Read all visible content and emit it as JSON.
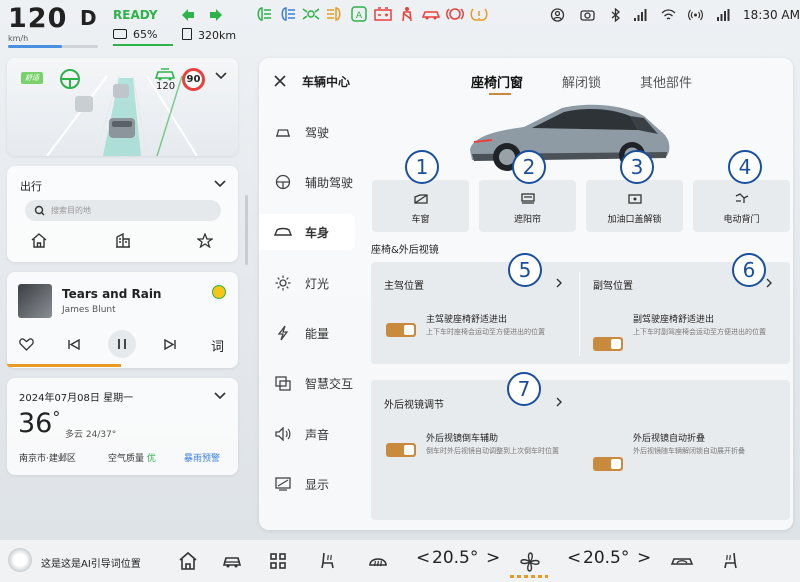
{
  "status": {
    "speed": "120",
    "speed_unit": "km/h",
    "gear": "D",
    "ready": "READY",
    "battery": "65%",
    "range": "320km",
    "time": "18:30 AM",
    "colors": {
      "ready": "#2db34a",
      "warning": "#e8413c",
      "amber": "#e89a22",
      "accent": "#c88a3c"
    }
  },
  "adas": {
    "mode": "舒适",
    "set_speed": "120",
    "limit": "90"
  },
  "nav": {
    "title": "出行",
    "search_placeholder": "搜索目的地"
  },
  "music": {
    "title": "Tears and Rain",
    "artist": "James Blunt",
    "lyrics_label": "词"
  },
  "weather": {
    "date": "2024年07月08日 星期一",
    "temp": "36",
    "deg": "°",
    "cond": "多云 24/37°",
    "location": "南京市·建邺区",
    "aqi_label": "空气质量",
    "aqi_value": "优",
    "alert": "暴雨预警"
  },
  "panel": {
    "title": "车辆中心",
    "sidebar": [
      {
        "label": "驾驶",
        "icon": "steering-wheel-icon"
      },
      {
        "label": "辅助驾驶",
        "icon": "assist-drive-icon"
      },
      {
        "label": "车身",
        "icon": "car-body-icon"
      },
      {
        "label": "灯光",
        "icon": "light-icon"
      },
      {
        "label": "能量",
        "icon": "energy-icon"
      },
      {
        "label": "智慧交互",
        "icon": "interaction-icon"
      },
      {
        "label": "声音",
        "icon": "sound-icon"
      },
      {
        "label": "显示",
        "icon": "display-icon"
      }
    ],
    "tabs": [
      "座椅门窗",
      "解闭锁",
      "其他部件"
    ],
    "quick": [
      "车窗",
      "遮阳帘",
      "加油口盖解锁",
      "电动背门"
    ],
    "markers": [
      "1",
      "2",
      "3",
      "4",
      "5",
      "6",
      "7"
    ],
    "section_seat": "座椅&外后视镜",
    "driver": {
      "title": "主驾位置",
      "opt": "主驾驶座椅舒适进出",
      "desc": "上下车时座椅会运动至方便进出的位置"
    },
    "passenger": {
      "title": "副驾位置",
      "opt": "副驾驶座椅舒适进出",
      "desc": "上下车时副驾座椅会运动至方便进出的位置"
    },
    "mirror": {
      "title": "外后视镜调节",
      "opt1": "外后视镜倒车辅助",
      "desc1": "倒车时外后视镜自动调整到上次倒车时位置",
      "opt2": "外后视镜自动折叠",
      "desc2": "外后视镜随车辆解闭锁自动展开折叠"
    }
  },
  "dock": {
    "ai": "这是这是AI引导词位置",
    "temp_left": "20.5°",
    "temp_right": "20.5°",
    "lt": "<",
    "gt": ">"
  }
}
